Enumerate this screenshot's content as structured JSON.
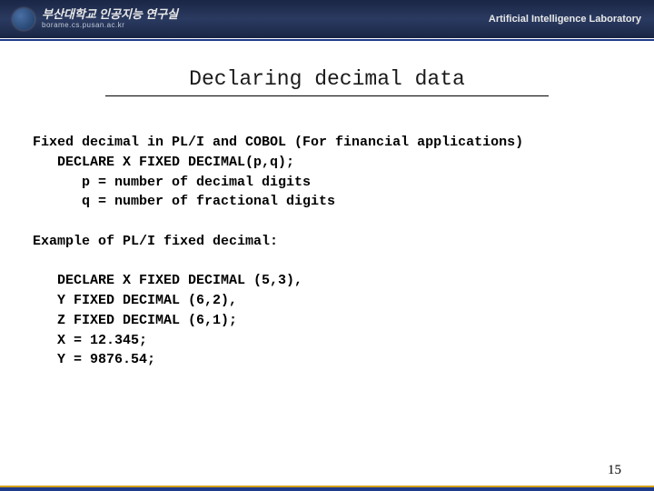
{
  "header": {
    "org_name": "부산대학교 인공지능 연구실",
    "org_url": "borame.cs.pusan.ac.kr",
    "lab_label": "Artificial Intelligence Laboratory"
  },
  "slide": {
    "title": "Declaring decimal data",
    "line1": "Fixed decimal in PL/I and COBOL (For financial applications)",
    "line2": "   DECLARE X FIXED DECIMAL(p,q);",
    "line3": "      p = number of decimal digits",
    "line4": "      q = number of fractional digits",
    "line5": "Example of PL/I fixed decimal:",
    "line6": "   DECLARE X FIXED DECIMAL (5,3),",
    "line7": "   Y FIXED DECIMAL (6,2),",
    "line8": "   Z FIXED DECIMAL (6,1);",
    "line9": "   X = 12.345;",
    "line10": "   Y = 9876.54;",
    "page_number": "15"
  }
}
